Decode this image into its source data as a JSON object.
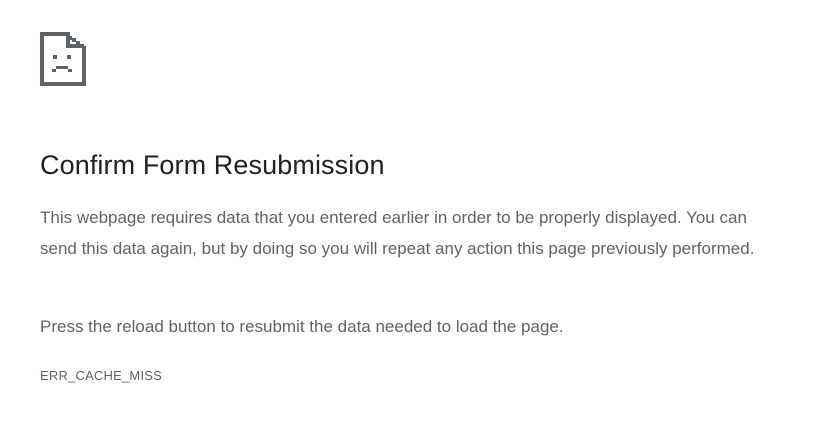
{
  "page": {
    "icon": "sad-document-icon",
    "title": "Confirm Form Resubmission",
    "paragraphs": [
      "This webpage requires data that you entered earlier in order to be properly displayed. You can send this data again, but by doing so you will repeat any action this page previously performed.",
      "Press the reload button to resubmit the data needed to load the page."
    ],
    "error_code": "ERR_CACHE_MISS"
  },
  "colors": {
    "title": "#202124",
    "body_text": "#5f6368",
    "icon": "#5f6368",
    "background": "#ffffff"
  }
}
